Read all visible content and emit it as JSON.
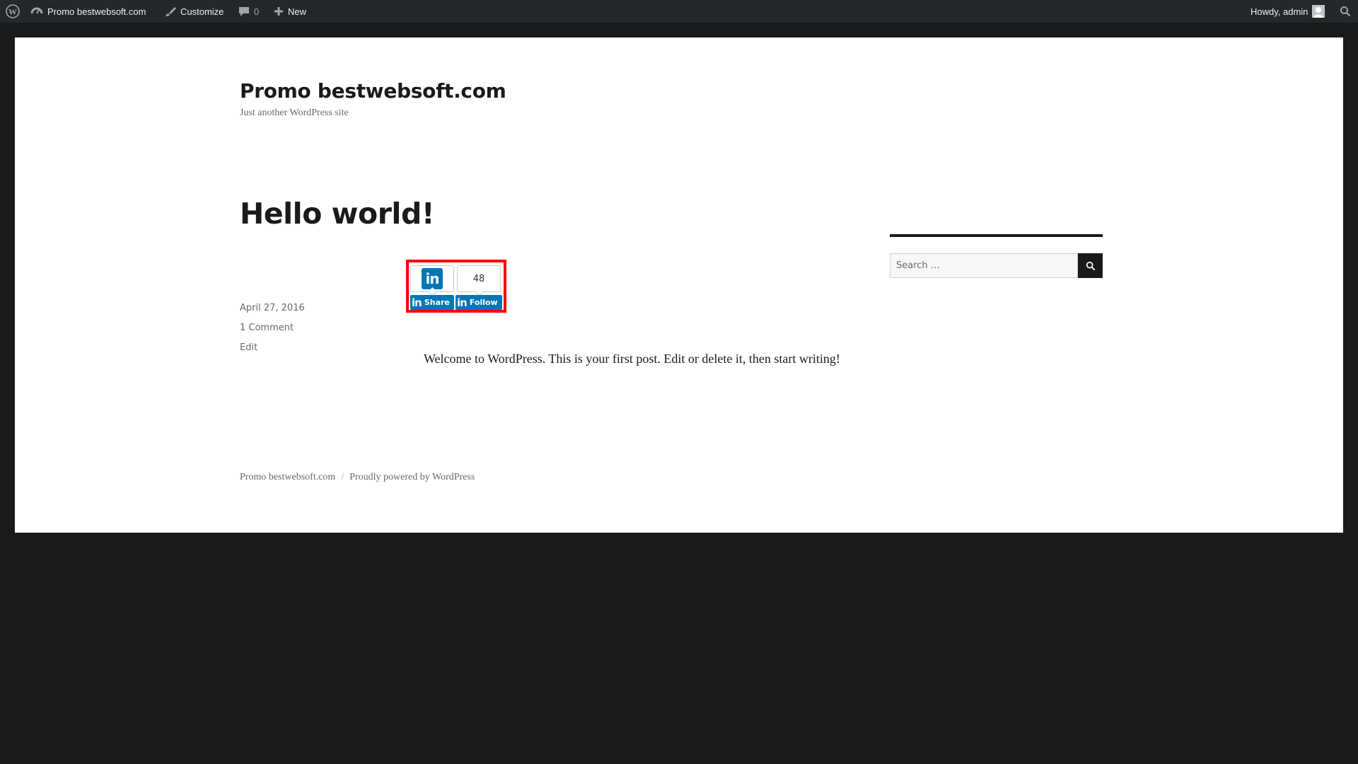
{
  "adminbar": {
    "wp_logo_icon": "wordpress-icon",
    "site_name": "Promo bestwebsoft.com",
    "customize": "Customize",
    "comments_count": "0",
    "new_label": "New",
    "howdy": "Howdy, admin"
  },
  "site": {
    "title": "Promo bestwebsoft.com",
    "description": "Just another WordPress site"
  },
  "post": {
    "title": "Hello world!",
    "date": "April 27, 2016",
    "comments": "1 Comment",
    "edit": "Edit",
    "content": "Welcome to WordPress. This is your first post. Edit or delete it, then start writing!"
  },
  "share_widget": {
    "logo_text": "in",
    "count": "48",
    "share_label": "Share",
    "follow_label": "Follow"
  },
  "sidebar": {
    "search_placeholder": "Search …"
  },
  "footer": {
    "site_link": "Promo bestwebsoft.com",
    "separator": "/",
    "powered": "Proudly powered by WordPress"
  }
}
